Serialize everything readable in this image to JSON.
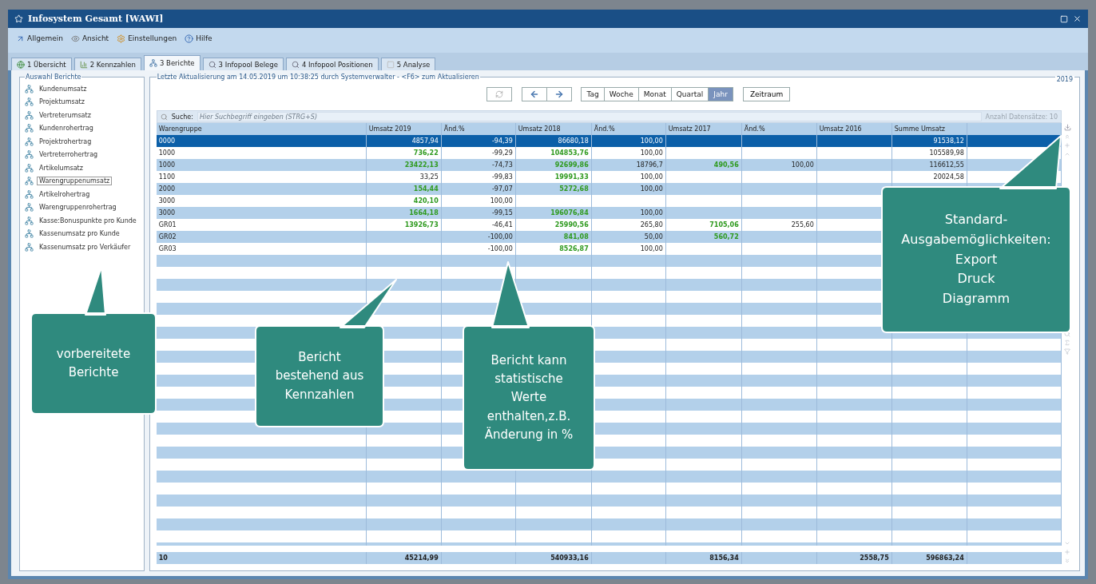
{
  "window": {
    "title": "Infosystem Gesamt [WAWI]"
  },
  "toolbar": [
    {
      "label": "Allgemein",
      "kind": "arrow"
    },
    {
      "label": "Ansicht",
      "kind": "view"
    },
    {
      "label": "Einstellungen",
      "kind": "settings"
    },
    {
      "label": "Hilfe",
      "kind": "help"
    }
  ],
  "tabs": [
    {
      "label": "1 Übersicht",
      "selected": false,
      "kind": "globe"
    },
    {
      "label": "2 Kennzahlen",
      "selected": false,
      "kind": "chart"
    },
    {
      "label": "3 Berichte",
      "selected": true,
      "kind": "report"
    },
    {
      "label": "3 Infopool Belege",
      "selected": false,
      "kind": "search"
    },
    {
      "label": "4 Infopool Positionen",
      "selected": false,
      "kind": "search"
    },
    {
      "label": "5 Analyse",
      "selected": false,
      "kind": "blank"
    }
  ],
  "sidebar": {
    "title": "Auswahl Berichte",
    "items": [
      {
        "label": "Kundenumsatz",
        "selected": false
      },
      {
        "label": "Projektumsatz",
        "selected": false
      },
      {
        "label": "Vertreterumsatz",
        "selected": false
      },
      {
        "label": "Kundenrohertrag",
        "selected": false
      },
      {
        "label": "Projektrohertrag",
        "selected": false
      },
      {
        "label": "Vertreterrohertrag",
        "selected": false
      },
      {
        "label": "Artikelumsatz",
        "selected": false
      },
      {
        "label": "Warengruppenumsatz",
        "selected": true
      },
      {
        "label": "Artikelrohertrag",
        "selected": false
      },
      {
        "label": "Warengruppenrohertrag",
        "selected": false
      },
      {
        "label": "Kasse:Bonuspunkte pro Kunde",
        "selected": false
      },
      {
        "label": "Kassenumsatz pro Kunde",
        "selected": false
      },
      {
        "label": "Kassenumsatz pro Verkäufer",
        "selected": false
      }
    ]
  },
  "report": {
    "status": "Letzte Aktualisierung am 14.05.2019 um 10:38:25 durch Systemverwalter - <F6> zum Aktualisieren",
    "year": "2019",
    "periods": [
      {
        "label": "Tag",
        "selected": false
      },
      {
        "label": "Woche",
        "selected": false
      },
      {
        "label": "Monat",
        "selected": false
      },
      {
        "label": "Quartal",
        "selected": false
      },
      {
        "label": "Jahr",
        "selected": true
      }
    ],
    "range_button": "Zeitraum",
    "search": {
      "label": "Suche:",
      "placeholder": "Hier Suchbegriff eingeben (STRG+S)"
    },
    "record_count": "Anzahl Datensätze: 10",
    "table": {
      "columns": [
        "Warengruppe",
        "Umsatz 2019",
        "Änd.%",
        "Umsatz 2018",
        "Änd.%",
        "Umsatz 2017",
        "Änd.%",
        "Umsatz 2016",
        "Summe Umsatz"
      ],
      "rows": [
        {
          "selected": true,
          "cells": [
            {
              "text": "0000"
            },
            {
              "text": "4857,94"
            },
            {
              "text": "-94,39"
            },
            {
              "text": "86680,18"
            },
            {
              "text": "100,00"
            },
            {},
            {},
            {},
            {
              "text": "91538,12"
            }
          ]
        },
        {
          "selected": false,
          "cells": [
            {
              "text": "1000"
            },
            {
              "text": "736,22",
              "emphasized": true
            },
            {
              "text": "-99,29"
            },
            {
              "text": "104853,76",
              "emphasized": true
            },
            {
              "text": "100,00"
            },
            {},
            {},
            {},
            {
              "text": "105589,98"
            }
          ]
        },
        {
          "selected": false,
          "cells": [
            {
              "text": "1000"
            },
            {
              "text": "23422,13",
              "emphasized": true
            },
            {
              "text": "-74,73"
            },
            {
              "text": "92699,86",
              "emphasized": true
            },
            {
              "text": "18796,7"
            },
            {
              "text": "490,56",
              "emphasized": true
            },
            {
              "text": "100,00"
            },
            {},
            {
              "text": "116612,55"
            }
          ]
        },
        {
          "selected": false,
          "cells": [
            {
              "text": "1100"
            },
            {
              "text": "33,25"
            },
            {
              "text": "-99,83"
            },
            {
              "text": "19991,33",
              "emphasized": true
            },
            {
              "text": "100,00"
            },
            {},
            {},
            {},
            {
              "text": "20024,58"
            }
          ]
        },
        {
          "selected": false,
          "cells": [
            {
              "text": "2000"
            },
            {
              "text": "154,44",
              "emphasized": true
            },
            {
              "text": "-97,07"
            },
            {
              "text": "5272,68",
              "emphasized": true
            },
            {
              "text": "100,00"
            },
            {},
            {},
            {},
            {}
          ]
        },
        {
          "selected": false,
          "cells": [
            {
              "text": "3000"
            },
            {
              "text": "420,10",
              "emphasized": true
            },
            {
              "text": "100,00"
            },
            {},
            {},
            {},
            {},
            {},
            {}
          ]
        },
        {
          "selected": false,
          "cells": [
            {
              "text": "3000"
            },
            {
              "text": "1664,18",
              "emphasized": true
            },
            {
              "text": "-99,15"
            },
            {
              "text": "196076,84",
              "emphasized": true
            },
            {
              "text": "100,00"
            },
            {},
            {},
            {},
            {}
          ]
        },
        {
          "selected": false,
          "cells": [
            {
              "text": "GR01"
            },
            {
              "text": "13926,73",
              "emphasized": true
            },
            {
              "text": "-46,41"
            },
            {
              "text": "25990,56",
              "emphasized": true
            },
            {
              "text": "265,80"
            },
            {
              "text": "7105,06",
              "emphasized": true
            },
            {
              "text": "255,60"
            },
            {},
            {}
          ]
        },
        {
          "selected": false,
          "cells": [
            {
              "text": "GR02"
            },
            {},
            {
              "text": "-100,00"
            },
            {
              "text": "841,08",
              "emphasized": true
            },
            {
              "text": "50,00"
            },
            {
              "text": "560,72",
              "emphasized": true
            },
            {},
            {},
            {}
          ]
        },
        {
          "selected": false,
          "cells": [
            {
              "text": "GR03"
            },
            {},
            {
              "text": "-100,00"
            },
            {
              "text": "8526,87",
              "emphasized": true
            },
            {
              "text": "100,00"
            },
            {},
            {},
            {},
            {}
          ]
        }
      ],
      "footer": {
        "count": "10",
        "umsatz_2019": "45214,99",
        "umsatz_2018": "540933,16",
        "umsatz_2017": "8156,34",
        "umsatz_2016": "2558,75",
        "summe_umsatz": "596863,24"
      }
    }
  },
  "callouts": [
    {
      "text": "vorbereitete\nBerichte"
    },
    {
      "text": "Bericht\nbestehend aus\nKennzahlen"
    },
    {
      "text": "Bericht kann\nstatistische\nWerte\nenthalten,z.B.\nÄnderung in %"
    },
    {
      "text": "Standard-\nAusgabemöglichkeiten:\nExport\nDruck\nDiagramm"
    }
  ]
}
